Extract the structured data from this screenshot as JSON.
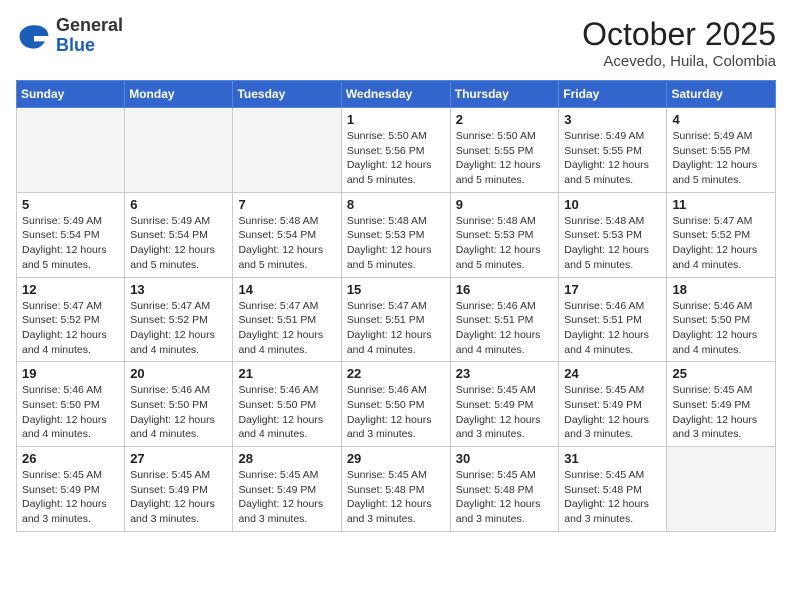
{
  "logo": {
    "general": "General",
    "blue": "Blue"
  },
  "title": {
    "month": "October 2025",
    "location": "Acevedo, Huila, Colombia"
  },
  "headers": [
    "Sunday",
    "Monday",
    "Tuesday",
    "Wednesday",
    "Thursday",
    "Friday",
    "Saturday"
  ],
  "weeks": [
    [
      {
        "day": "",
        "info": ""
      },
      {
        "day": "",
        "info": ""
      },
      {
        "day": "",
        "info": ""
      },
      {
        "day": "1",
        "info": "Sunrise: 5:50 AM\nSunset: 5:56 PM\nDaylight: 12 hours\nand 5 minutes."
      },
      {
        "day": "2",
        "info": "Sunrise: 5:50 AM\nSunset: 5:55 PM\nDaylight: 12 hours\nand 5 minutes."
      },
      {
        "day": "3",
        "info": "Sunrise: 5:49 AM\nSunset: 5:55 PM\nDaylight: 12 hours\nand 5 minutes."
      },
      {
        "day": "4",
        "info": "Sunrise: 5:49 AM\nSunset: 5:55 PM\nDaylight: 12 hours\nand 5 minutes."
      }
    ],
    [
      {
        "day": "5",
        "info": "Sunrise: 5:49 AM\nSunset: 5:54 PM\nDaylight: 12 hours\nand 5 minutes."
      },
      {
        "day": "6",
        "info": "Sunrise: 5:49 AM\nSunset: 5:54 PM\nDaylight: 12 hours\nand 5 minutes."
      },
      {
        "day": "7",
        "info": "Sunrise: 5:48 AM\nSunset: 5:54 PM\nDaylight: 12 hours\nand 5 minutes."
      },
      {
        "day": "8",
        "info": "Sunrise: 5:48 AM\nSunset: 5:53 PM\nDaylight: 12 hours\nand 5 minutes."
      },
      {
        "day": "9",
        "info": "Sunrise: 5:48 AM\nSunset: 5:53 PM\nDaylight: 12 hours\nand 5 minutes."
      },
      {
        "day": "10",
        "info": "Sunrise: 5:48 AM\nSunset: 5:53 PM\nDaylight: 12 hours\nand 5 minutes."
      },
      {
        "day": "11",
        "info": "Sunrise: 5:47 AM\nSunset: 5:52 PM\nDaylight: 12 hours\nand 4 minutes."
      }
    ],
    [
      {
        "day": "12",
        "info": "Sunrise: 5:47 AM\nSunset: 5:52 PM\nDaylight: 12 hours\nand 4 minutes."
      },
      {
        "day": "13",
        "info": "Sunrise: 5:47 AM\nSunset: 5:52 PM\nDaylight: 12 hours\nand 4 minutes."
      },
      {
        "day": "14",
        "info": "Sunrise: 5:47 AM\nSunset: 5:51 PM\nDaylight: 12 hours\nand 4 minutes."
      },
      {
        "day": "15",
        "info": "Sunrise: 5:47 AM\nSunset: 5:51 PM\nDaylight: 12 hours\nand 4 minutes."
      },
      {
        "day": "16",
        "info": "Sunrise: 5:46 AM\nSunset: 5:51 PM\nDaylight: 12 hours\nand 4 minutes."
      },
      {
        "day": "17",
        "info": "Sunrise: 5:46 AM\nSunset: 5:51 PM\nDaylight: 12 hours\nand 4 minutes."
      },
      {
        "day": "18",
        "info": "Sunrise: 5:46 AM\nSunset: 5:50 PM\nDaylight: 12 hours\nand 4 minutes."
      }
    ],
    [
      {
        "day": "19",
        "info": "Sunrise: 5:46 AM\nSunset: 5:50 PM\nDaylight: 12 hours\nand 4 minutes."
      },
      {
        "day": "20",
        "info": "Sunrise: 5:46 AM\nSunset: 5:50 PM\nDaylight: 12 hours\nand 4 minutes."
      },
      {
        "day": "21",
        "info": "Sunrise: 5:46 AM\nSunset: 5:50 PM\nDaylight: 12 hours\nand 4 minutes."
      },
      {
        "day": "22",
        "info": "Sunrise: 5:46 AM\nSunset: 5:50 PM\nDaylight: 12 hours\nand 3 minutes."
      },
      {
        "day": "23",
        "info": "Sunrise: 5:45 AM\nSunset: 5:49 PM\nDaylight: 12 hours\nand 3 minutes."
      },
      {
        "day": "24",
        "info": "Sunrise: 5:45 AM\nSunset: 5:49 PM\nDaylight: 12 hours\nand 3 minutes."
      },
      {
        "day": "25",
        "info": "Sunrise: 5:45 AM\nSunset: 5:49 PM\nDaylight: 12 hours\nand 3 minutes."
      }
    ],
    [
      {
        "day": "26",
        "info": "Sunrise: 5:45 AM\nSunset: 5:49 PM\nDaylight: 12 hours\nand 3 minutes."
      },
      {
        "day": "27",
        "info": "Sunrise: 5:45 AM\nSunset: 5:49 PM\nDaylight: 12 hours\nand 3 minutes."
      },
      {
        "day": "28",
        "info": "Sunrise: 5:45 AM\nSunset: 5:49 PM\nDaylight: 12 hours\nand 3 minutes."
      },
      {
        "day": "29",
        "info": "Sunrise: 5:45 AM\nSunset: 5:48 PM\nDaylight: 12 hours\nand 3 minutes."
      },
      {
        "day": "30",
        "info": "Sunrise: 5:45 AM\nSunset: 5:48 PM\nDaylight: 12 hours\nand 3 minutes."
      },
      {
        "day": "31",
        "info": "Sunrise: 5:45 AM\nSunset: 5:48 PM\nDaylight: 12 hours\nand 3 minutes."
      },
      {
        "day": "",
        "info": ""
      }
    ]
  ]
}
